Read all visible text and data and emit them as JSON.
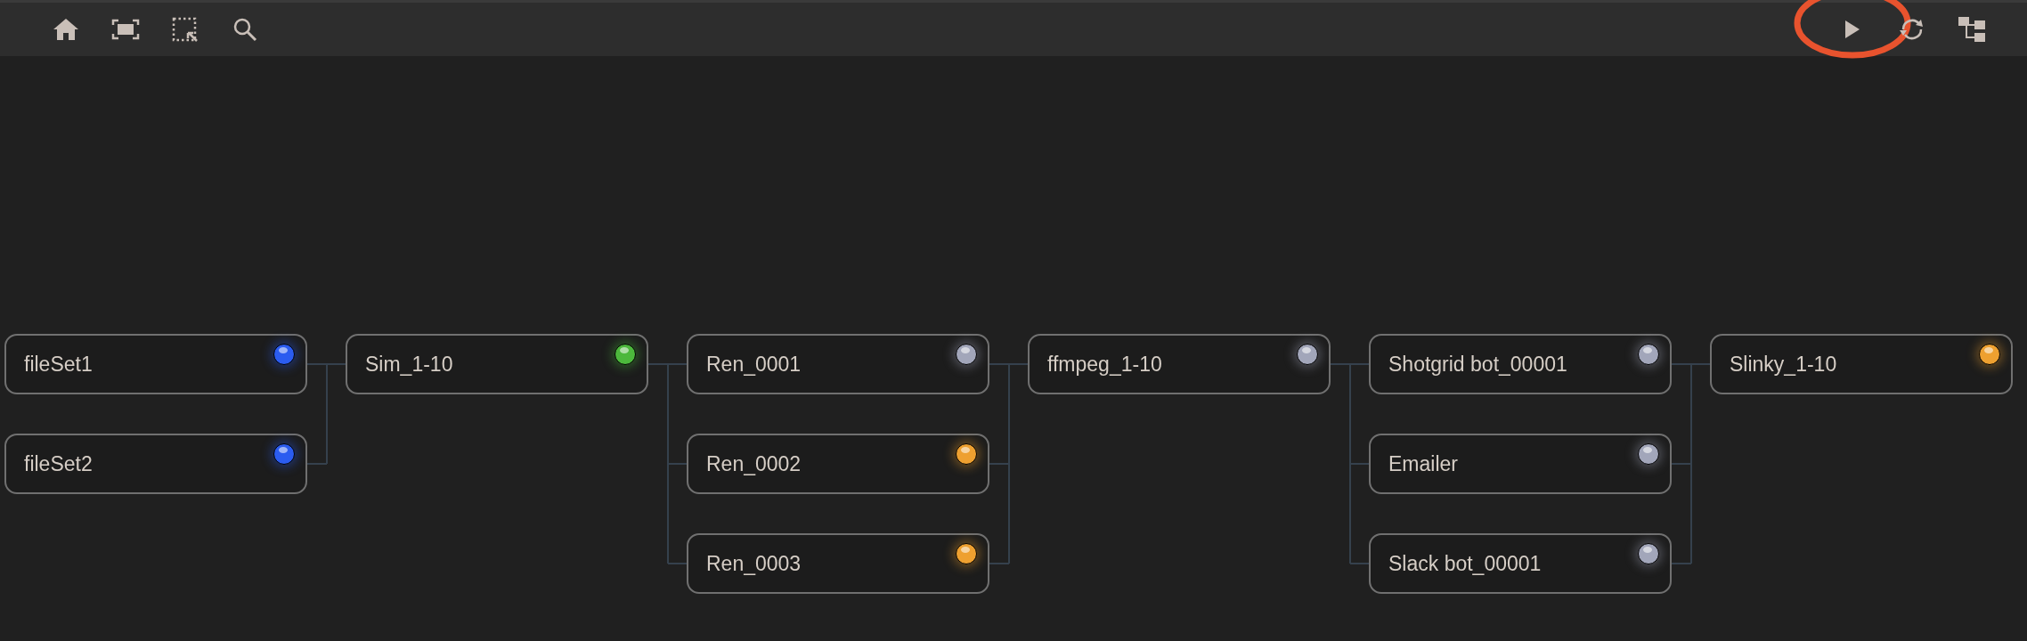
{
  "toolbar": {
    "left": [
      {
        "kind": "home"
      },
      {
        "kind": "fit"
      },
      {
        "kind": "select"
      },
      {
        "kind": "search"
      }
    ],
    "right": [
      {
        "kind": "play",
        "circled": true
      },
      {
        "kind": "refresh",
        "circled": false
      },
      {
        "kind": "tree",
        "circled": false
      }
    ]
  },
  "columns": [
    {
      "nodes": [
        {
          "label": "fileSet1",
          "color": "#2b5cf0"
        },
        {
          "label": "fileSet2",
          "color": "#2b5cf0"
        }
      ]
    },
    {
      "nodes": [
        {
          "label": "Sim_1-10",
          "color": "#4cb83c"
        }
      ]
    },
    {
      "nodes": [
        {
          "label": "Ren_0001",
          "color": "#a2a6ba"
        },
        {
          "label": "Ren_0002",
          "color": "#eea030"
        },
        {
          "label": "Ren_0003",
          "color": "#eea030"
        }
      ]
    },
    {
      "nodes": [
        {
          "label": "ffmpeg_1-10",
          "color": "#a2a6ba"
        }
      ]
    },
    {
      "nodes": [
        {
          "label": "Shotgrid bot_00001",
          "color": "#a2a6ba"
        },
        {
          "label": "Emailer",
          "color": "#a2a6ba"
        },
        {
          "label": "Slack bot_00001",
          "color": "#a2a6ba"
        }
      ]
    },
    {
      "nodes": [
        {
          "label": "Slinky_1-10",
          "color": "#eea030"
        }
      ]
    }
  ]
}
